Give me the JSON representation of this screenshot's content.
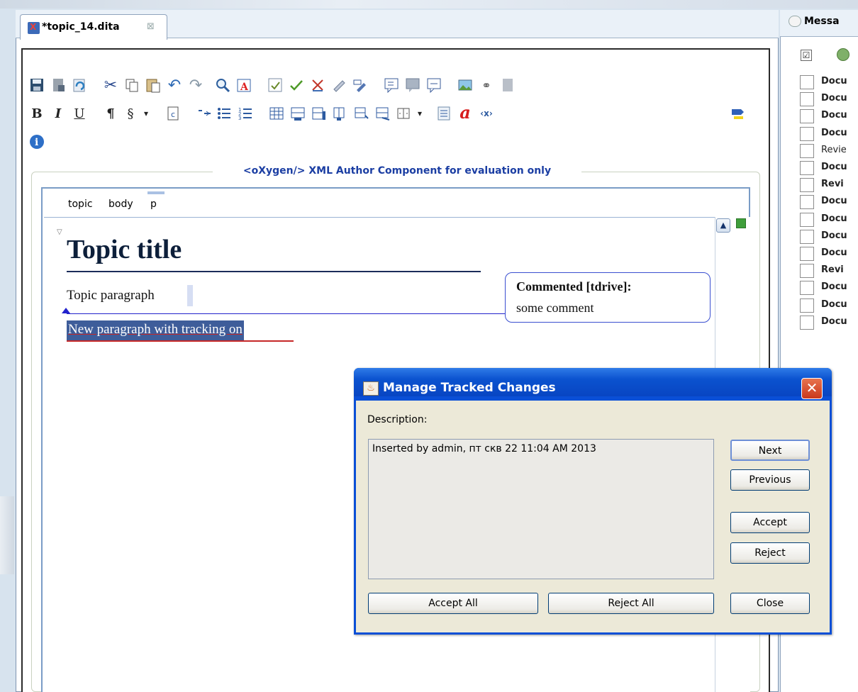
{
  "editor": {
    "tab_title": "*topic_14.dita",
    "tab_close": "⊠",
    "watermark": "<oXygen/> XML Author Component for evaluation only",
    "breadcrumb": [
      "topic",
      "body",
      "p"
    ]
  },
  "toolbar": {
    "bold": "B",
    "italic": "I",
    "underline": "U",
    "pilcrow": "¶",
    "section": "§",
    "dropdown": "▾",
    "info": "i",
    "icons": [
      "save-icon",
      "save-as-icon",
      "revert-icon",
      "cut-icon",
      "copy-icon",
      "paste-icon",
      "undo-icon",
      "redo-icon",
      "find-icon",
      "insert-image-icon",
      "track-changes-icon",
      "accept-change-icon",
      "reject-change-icon",
      "comment-change-icon",
      "manage-changes-icon",
      "add-comment-icon",
      "edit-comment-icon",
      "remove-comment-icon",
      "image-icon",
      "link-icon",
      "document-icon"
    ]
  },
  "document": {
    "title": "Topic title",
    "paragraph1": "Topic paragraph",
    "paragraph2": "New paragraph with tracking on",
    "comment_author": "Commented [tdrive]:",
    "comment_text": "some comment"
  },
  "side_panel": {
    "title": "Messa",
    "header_check": "☑",
    "rows": [
      {
        "label": "Docu",
        "bold": true
      },
      {
        "label": "Docu",
        "bold": true
      },
      {
        "label": "Docu",
        "bold": true
      },
      {
        "label": "Docu",
        "bold": true
      },
      {
        "label": "Revie",
        "bold": false
      },
      {
        "label": "Docu",
        "bold": true
      },
      {
        "label": "Revi",
        "bold": true
      },
      {
        "label": "Docu",
        "bold": true
      },
      {
        "label": "Docu",
        "bold": true
      },
      {
        "label": "Docu",
        "bold": true
      },
      {
        "label": "Docu",
        "bold": true
      },
      {
        "label": "Revi",
        "bold": true
      },
      {
        "label": "Docu",
        "bold": true
      },
      {
        "label": "Docu",
        "bold": true
      },
      {
        "label": "Docu",
        "bold": true
      }
    ]
  },
  "dialog": {
    "title": "Manage Tracked Changes",
    "close": "✕",
    "description_label": "Description:",
    "description_text": "Inserted by admin, пт скв 22 11:04 AM 2013",
    "buttons": {
      "next": "Next",
      "previous": "Previous",
      "accept": "Accept",
      "reject": "Reject",
      "accept_all": "Accept All",
      "reject_all": "Reject All",
      "close": "Close"
    }
  }
}
